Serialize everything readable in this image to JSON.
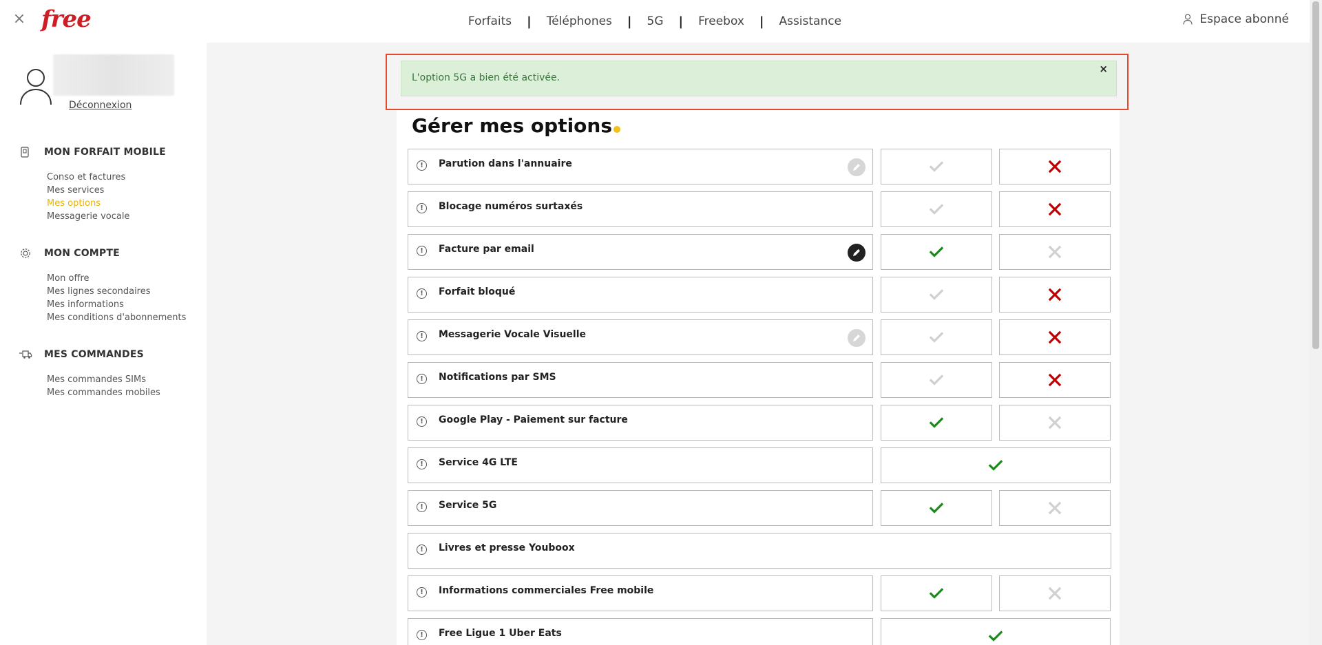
{
  "header": {
    "close_symbol": "×",
    "logo": "free",
    "nav": [
      {
        "label": "Forfaits"
      },
      {
        "label": "Téléphones"
      },
      {
        "label": "5G"
      },
      {
        "label": "Freebox"
      },
      {
        "label": "Assistance"
      }
    ],
    "nav_separator": "|",
    "account_label": "Espace abonné"
  },
  "sidebar": {
    "logout_label": "Déconnexion",
    "sections": [
      {
        "title": "MON FORFAIT MOBILE",
        "icon": "phone-doc-icon",
        "items": [
          {
            "label": "Conso et factures",
            "active": false
          },
          {
            "label": "Mes services",
            "active": false
          },
          {
            "label": "Mes options",
            "active": true
          },
          {
            "label": "Messagerie vocale",
            "active": false
          }
        ]
      },
      {
        "title": "MON COMPTE",
        "icon": "gear-icon",
        "items": [
          {
            "label": "Mon offre",
            "active": false
          },
          {
            "label": "Mes lignes secondaires",
            "active": false
          },
          {
            "label": "Mes informations",
            "active": false
          },
          {
            "label": "Mes conditions d'abonnements",
            "active": false
          }
        ]
      },
      {
        "title": "MES COMMANDES",
        "icon": "delivery-truck-icon",
        "items": [
          {
            "label": "Mes commandes SIMs",
            "active": false
          },
          {
            "label": "Mes commandes mobiles",
            "active": false
          }
        ]
      }
    ]
  },
  "alert": {
    "message": "L'option 5G a bien été activée.",
    "dismiss_symbol": "×"
  },
  "page": {
    "title_prefix": "Gérer",
    "title_bold": "mes options"
  },
  "info_symbol": "!",
  "options": [
    {
      "label": "Parution dans l'annuaire",
      "layout": "split",
      "edit": "light",
      "state": "off"
    },
    {
      "label": "Blocage numéros surtaxés",
      "layout": "split",
      "edit": "none",
      "state": "off"
    },
    {
      "label": "Facture par email",
      "layout": "split",
      "edit": "dark",
      "state": "on"
    },
    {
      "label": "Forfait bloqué",
      "layout": "split",
      "edit": "none",
      "state": "off"
    },
    {
      "label": "Messagerie Vocale Visuelle",
      "layout": "split",
      "edit": "light",
      "state": "off"
    },
    {
      "label": "Notifications par SMS",
      "layout": "split",
      "edit": "none",
      "state": "off"
    },
    {
      "label": "Google Play - Paiement sur facture",
      "layout": "split",
      "edit": "none",
      "state": "on"
    },
    {
      "label": "Service 4G LTE",
      "layout": "single",
      "edit": "none",
      "state": "on"
    },
    {
      "label": "Service 5G",
      "layout": "split",
      "edit": "none",
      "state": "on"
    },
    {
      "label": "Livres et presse Youboox",
      "layout": "full",
      "edit": "none",
      "state": "none"
    },
    {
      "label": "Informations commerciales Free mobile",
      "layout": "split",
      "edit": "none",
      "state": "on"
    },
    {
      "label": "Free Ligue 1 Uber Eats",
      "layout": "single",
      "edit": "none",
      "state": "on"
    }
  ],
  "colors": {
    "brand_red": "#cd1e25",
    "active_yellow": "#e8b400",
    "check_green": "#1a8a1a",
    "cross_red": "#c00000",
    "inactive_grey": "#d0d0d0",
    "alert_bg": "#dcefd8",
    "highlight_outline": "#e34b2c"
  }
}
